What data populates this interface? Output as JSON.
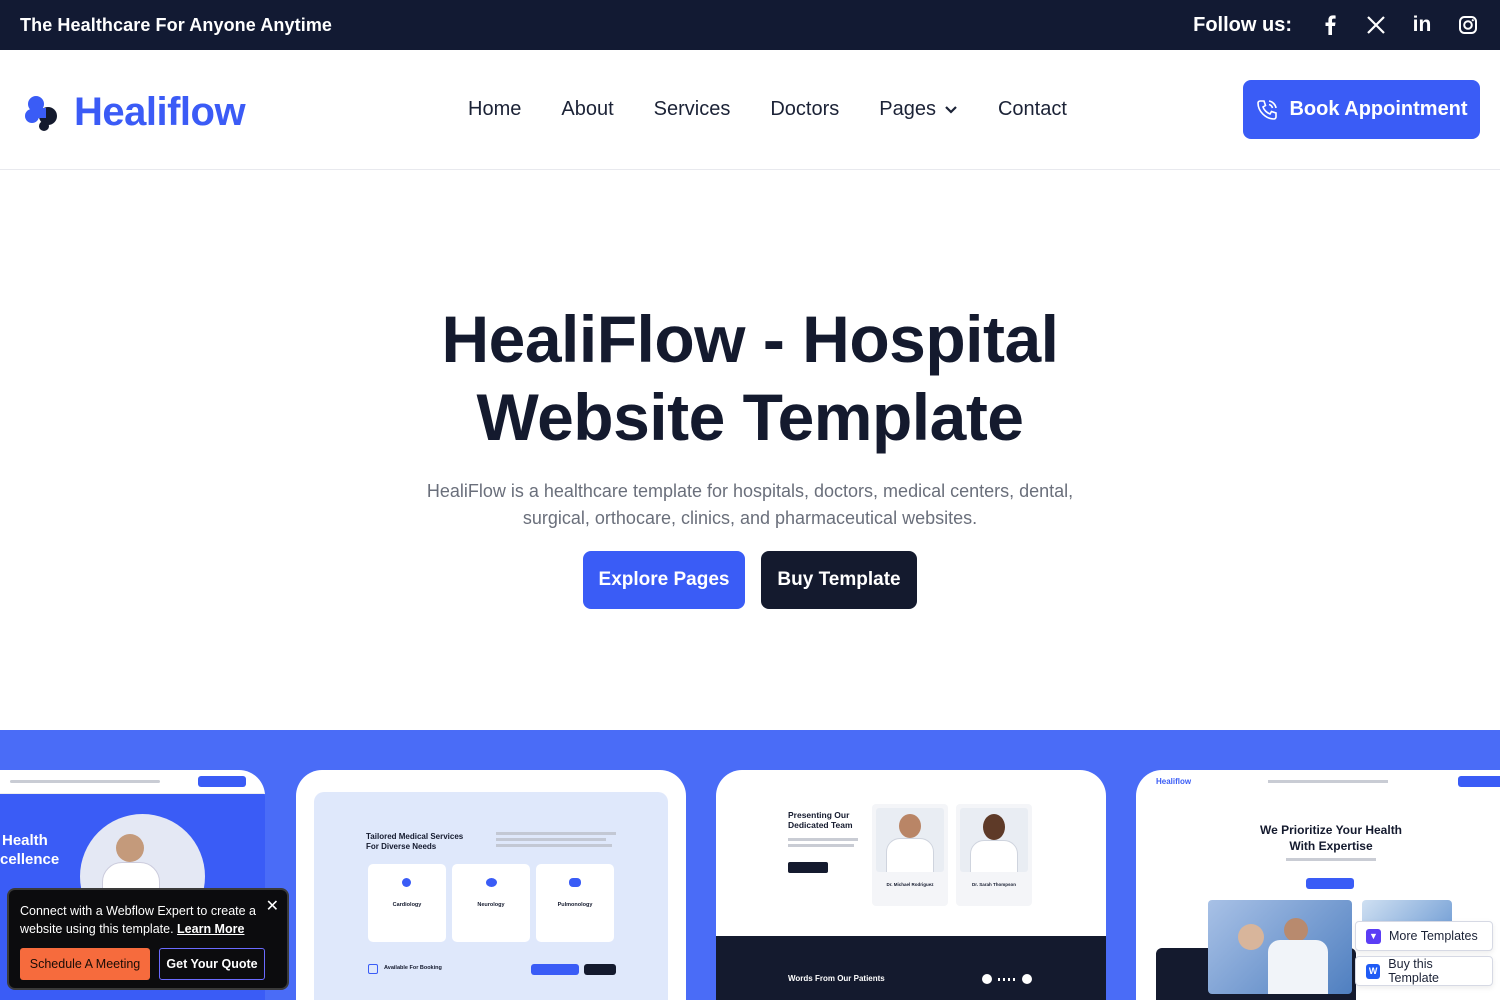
{
  "topbar": {
    "tagline": "The Healthcare For Anyone Anytime",
    "follow_label": "Follow us:",
    "social": [
      "facebook-icon",
      "x-icon",
      "linkedin-icon",
      "instagram-icon"
    ]
  },
  "header": {
    "logo_text": "Healiflow",
    "nav": [
      "Home",
      "About",
      "Services",
      "Doctors",
      "Pages",
      "Contact"
    ],
    "book_label": "Book Appointment"
  },
  "hero": {
    "title_line1": "HealiFlow - Hospital",
    "title_line2": "Website Template",
    "subtitle": "HealiFlow is a healthcare template for hospitals, doctors, medical centers, dental, surgical, orthocare, clinics, and pharmaceutical websites.",
    "explore_label": "Explore Pages",
    "buy_label": "Buy Template"
  },
  "showcase": {
    "card1": {
      "heading1": "Health",
      "heading2": "cellence"
    },
    "card2": {
      "heading": "Tailored Medical Services For Diverse Needs",
      "services": [
        "Cardiology",
        "Neurology",
        "Pulmonology"
      ],
      "booking": "Available For Booking"
    },
    "card3": {
      "heading": "Presenting Our Dedicated Team",
      "doctors": [
        "Dr. Michael Rodriguez",
        "Dr. Sarah Thompson"
      ],
      "testimonials": "Words From Our Patients"
    },
    "card4": {
      "logo": "Healiflow",
      "heading": "We Prioritize Your Health With Expertise"
    }
  },
  "popup": {
    "message": "Connect with a Webflow Expert to create a website using this template.",
    "learn_more": "Learn More",
    "schedule_label": "Schedule A Meeting",
    "quote_label": "Get Your Quote"
  },
  "floating": {
    "more_templates": "More Templates",
    "buy_this_template": "Buy this Template"
  },
  "colors": {
    "primary": "#3a5cf6",
    "dark": "#141a2e",
    "topbar": "#121a33",
    "accent_orange": "#f66b3d"
  }
}
